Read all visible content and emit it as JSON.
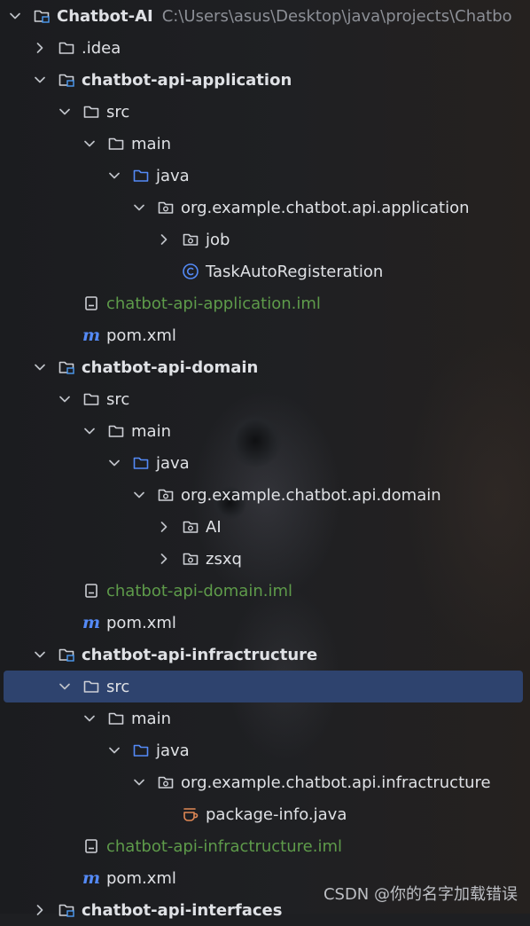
{
  "tree": {
    "rows": [
      {
        "label": "Chatbot-AI",
        "path": "C:\\Users\\asus\\Desktop\\java\\projects\\Chatbo",
        "kind": "module-folder",
        "indent": 0,
        "expanded": true,
        "bold": true
      },
      {
        "label": ".idea",
        "kind": "folder",
        "indent": 1,
        "expanded": false
      },
      {
        "label": "chatbot-api-application",
        "kind": "module-folder",
        "indent": 1,
        "expanded": true,
        "bold": true
      },
      {
        "label": "src",
        "kind": "folder",
        "indent": 2,
        "expanded": true
      },
      {
        "label": "main",
        "kind": "folder",
        "indent": 3,
        "expanded": true
      },
      {
        "label": "java",
        "kind": "source-folder",
        "indent": 4,
        "expanded": true
      },
      {
        "label": "org.example.chatbot.api.application",
        "kind": "package",
        "indent": 5,
        "expanded": true
      },
      {
        "label": "job",
        "kind": "package",
        "indent": 6,
        "expanded": false
      },
      {
        "label": "TaskAutoRegisteration",
        "kind": "class",
        "indent": 6,
        "expanded": null
      },
      {
        "label": "chatbot-api-application.iml",
        "kind": "iml",
        "indent": 2,
        "expanded": null,
        "green": true
      },
      {
        "label": "pom.xml",
        "kind": "maven",
        "indent": 2,
        "expanded": null
      },
      {
        "label": "chatbot-api-domain",
        "kind": "module-folder",
        "indent": 1,
        "expanded": true,
        "bold": true
      },
      {
        "label": "src",
        "kind": "folder",
        "indent": 2,
        "expanded": true
      },
      {
        "label": "main",
        "kind": "folder",
        "indent": 3,
        "expanded": true
      },
      {
        "label": "java",
        "kind": "source-folder",
        "indent": 4,
        "expanded": true
      },
      {
        "label": "org.example.chatbot.api.domain",
        "kind": "package",
        "indent": 5,
        "expanded": true
      },
      {
        "label": "AI",
        "kind": "package",
        "indent": 6,
        "expanded": false
      },
      {
        "label": "zsxq",
        "kind": "package",
        "indent": 6,
        "expanded": false
      },
      {
        "label": "chatbot-api-domain.iml",
        "kind": "iml",
        "indent": 2,
        "expanded": null,
        "green": true
      },
      {
        "label": "pom.xml",
        "kind": "maven",
        "indent": 2,
        "expanded": null
      },
      {
        "label": "chatbot-api-infractructure",
        "kind": "module-folder",
        "indent": 1,
        "expanded": true,
        "bold": true
      },
      {
        "label": "src",
        "kind": "folder",
        "indent": 2,
        "expanded": true,
        "selected": true
      },
      {
        "label": "main",
        "kind": "folder",
        "indent": 3,
        "expanded": true
      },
      {
        "label": "java",
        "kind": "source-folder",
        "indent": 4,
        "expanded": true
      },
      {
        "label": "org.example.chatbot.api.infractructure",
        "kind": "package",
        "indent": 5,
        "expanded": true
      },
      {
        "label": "package-info.java",
        "kind": "package-info",
        "indent": 6,
        "expanded": null
      },
      {
        "label": "chatbot-api-infractructure.iml",
        "kind": "iml",
        "indent": 2,
        "expanded": null,
        "green": true
      },
      {
        "label": "pom.xml",
        "kind": "maven",
        "indent": 2,
        "expanded": null
      },
      {
        "label": "chatbot-api-interfaces",
        "kind": "module-folder",
        "indent": 1,
        "expanded": false,
        "bold": true
      }
    ]
  },
  "watermark": "CSDN @你的名字加载错误",
  "colors": {
    "background": "#1e1f22",
    "text": "#dfe1e5",
    "path": "#8c8f96",
    "selection": "#2e436e",
    "iml_text": "#5e9b4a",
    "folder_icon": "#ced0d6",
    "source_folder_icon": "#548af7",
    "class_icon": "#548af7",
    "maven_icon": "#548af7",
    "package_info_icon": "#e08855"
  }
}
